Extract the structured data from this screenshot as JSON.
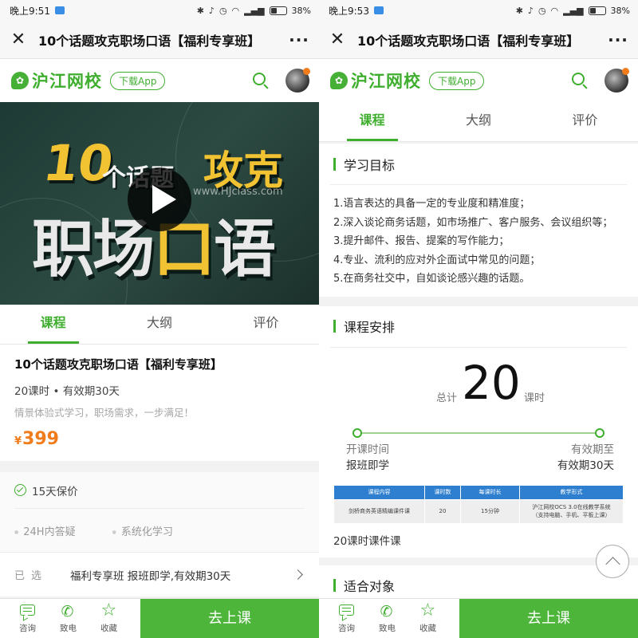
{
  "left": {
    "status": {
      "time": "晚上9:51",
      "battery": "38%"
    },
    "title": "10个话题攻克职场口语【福利专享班】",
    "site": {
      "logo": "沪江网校",
      "download": "下载App"
    },
    "banner": {
      "line1_num": "10",
      "line1_mid": "个话题",
      "line1_end": "攻克",
      "line2a": "职场",
      "line2b": "口",
      "line2c": "语",
      "watermark": "www.HJclass.com"
    },
    "tabs": [
      "课程",
      "大纲",
      "评价"
    ],
    "course": {
      "title": "10个话题攻克职场口语【福利专享班】",
      "meta": "20课时 • 有效期30天",
      "subtitle": "情景体验式学习，职场需求，一步满足！",
      "currency": "¥",
      "price": "399"
    },
    "guarantee": {
      "main": "15天保价",
      "items": [
        "24H内答疑",
        "系统化学习"
      ]
    },
    "selected": {
      "label": "已选",
      "value": "福利专享班 报班即学,有效期30天"
    },
    "bottom": {
      "consult": "咨询",
      "call": "致电",
      "fav": "收藏",
      "go": "去上课"
    }
  },
  "right": {
    "status": {
      "time": "晚上9:53",
      "battery": "38%"
    },
    "title": "10个话题攻克职场口语【福利专享班】",
    "site": {
      "logo": "沪江网校",
      "download": "下载App"
    },
    "tabs": [
      "课程",
      "大纲",
      "评价"
    ],
    "goals": {
      "heading": "学习目标",
      "items": [
        "1.语言表达的具备一定的专业度和精准度；",
        "2.深入谈论商务话题，如市场推广、客户服务、会议组织等；",
        "3.提升邮件、报告、提案的写作能力；",
        "4.专业、流利的应对外企面试中常见的问题；",
        "5.在商务社交中，自如谈论感兴趣的话题。"
      ]
    },
    "schedule": {
      "heading": "课程安排",
      "total_label": "总计",
      "total": "20",
      "unit": "课时",
      "start_key": "开课时间",
      "start_val": "报班即学",
      "end_key": "有效期至",
      "end_val": "有效期30天",
      "table_headers": [
        "课程内容",
        "课时数",
        "每课时长",
        "教学形式"
      ],
      "table_row": [
        "剑桥商务英语精编课件课",
        "20",
        "15分钟",
        "沪江网校OCS 3.0在线教学系统",
        "（支持电脑、手机、平板上课）"
      ],
      "caption": "20课时课件课"
    },
    "audience": {
      "heading": "适合对象"
    },
    "bottom": {
      "consult": "咨询",
      "call": "致电",
      "fav": "收藏",
      "go": "去上课"
    }
  }
}
